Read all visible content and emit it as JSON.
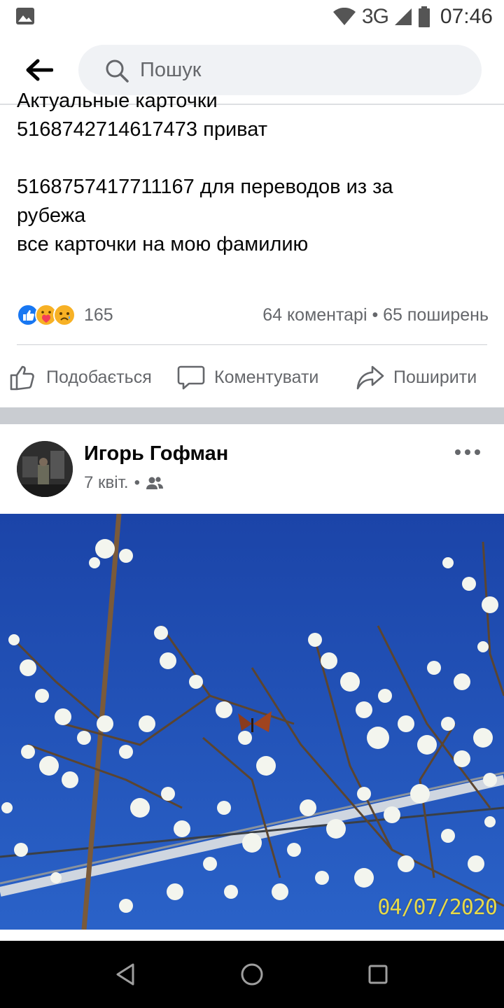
{
  "status_bar": {
    "network": "3G",
    "time": "07:46",
    "icons": [
      "gallery-icon",
      "wifi-icon",
      "signal-icon",
      "battery-icon"
    ]
  },
  "search": {
    "placeholder": "Пошук",
    "back_icon": "arrow-left-icon",
    "search_icon": "magnifier-icon"
  },
  "post1": {
    "text_lines": [
      "Актуальные карточки",
      "5168742714617473 приват",
      "",
      "5168757417711167 для переводов из за",
      "рубежа",
      "все карточки на мою фамилию"
    ],
    "reactions": {
      "icons": [
        "like-reaction-icon",
        "care-reaction-icon",
        "sad-reaction-icon"
      ],
      "count": "165",
      "comments_shares": "64 коментарі • 65 поширень"
    },
    "actions": {
      "like": "Подобається",
      "comment": "Коментувати",
      "share": "Поширити"
    }
  },
  "post2": {
    "author": "Игорь Гофман",
    "date": "7 квіт.",
    "audience_icon": "friends-icon",
    "photo": {
      "date_stamp": "04/07/2020"
    }
  },
  "colors": {
    "secondary_text": "#65676b",
    "search_bg": "#f0f2f5",
    "separator": "#c9ccd1",
    "sky": "#1e4fb0",
    "like_blue": "#1877f2"
  },
  "nav_bar": {
    "icons": [
      "nav-back-icon",
      "nav-home-icon",
      "nav-recents-icon"
    ]
  }
}
